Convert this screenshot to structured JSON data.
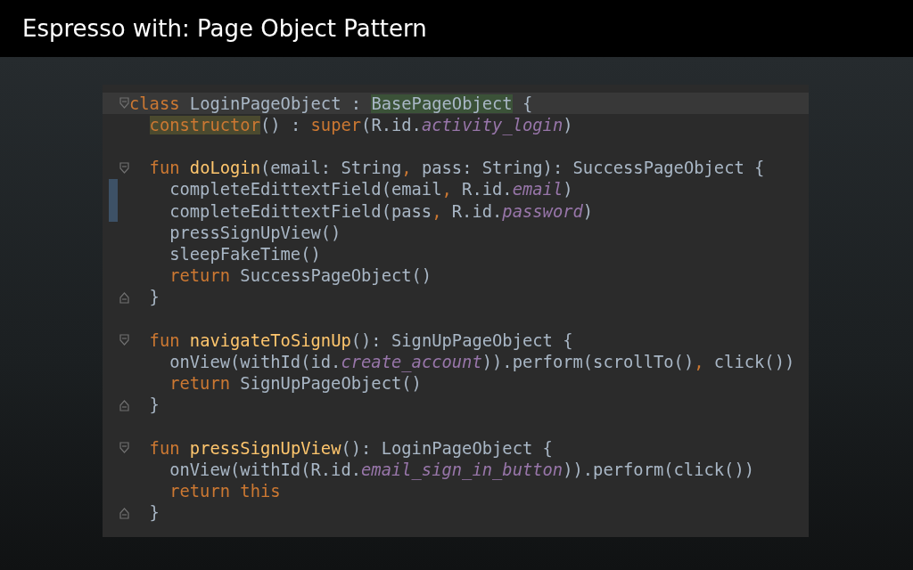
{
  "slide": {
    "title": "Espresso with: Page Object Pattern"
  },
  "editor": {
    "lines": [
      {
        "kind": "code",
        "fold_open": true,
        "current": true,
        "tokens": [
          {
            "t": "class ",
            "kind": "keyword"
          },
          {
            "t": "LoginPageObject : ",
            "kind": "plain"
          },
          {
            "t": "BasePageObject",
            "kind": "plain",
            "highlighted": true
          },
          {
            "t": " {",
            "kind": "plain"
          }
        ],
        "children": [
          {
            "kind": "code",
            "tokens": [
              {
                "t": "constructor",
                "kind": "keyword",
                "highlighted": true
              },
              {
                "t": "() : ",
                "kind": "plain"
              },
              {
                "t": "super",
                "kind": "keyword"
              },
              {
                "t": "(R.id.",
                "kind": "plain"
              },
              {
                "t": "activity_login",
                "kind": "field"
              },
              {
                "t": ")",
                "kind": "plain"
              }
            ]
          },
          {
            "kind": "blank"
          },
          {
            "kind": "code",
            "fold_open": true,
            "tokens": [
              {
                "t": "fun ",
                "kind": "keyword"
              },
              {
                "t": "doLogin",
                "kind": "decl"
              },
              {
                "t": "(email: String",
                "kind": "plain"
              },
              {
                "t": ", ",
                "kind": "keyword"
              },
              {
                "t": "pass: String): SuccessPageObject {",
                "kind": "plain"
              }
            ],
            "children": [
              {
                "kind": "code",
                "changed": true,
                "tokens": [
                  {
                    "t": "completeEdittextField(email",
                    "kind": "plain"
                  },
                  {
                    "t": ", ",
                    "kind": "keyword"
                  },
                  {
                    "t": "R.id.",
                    "kind": "plain"
                  },
                  {
                    "t": "email",
                    "kind": "field"
                  },
                  {
                    "t": ")",
                    "kind": "plain"
                  }
                ]
              },
              {
                "kind": "code",
                "changed": true,
                "tokens": [
                  {
                    "t": "completeEdittextField(pass",
                    "kind": "plain"
                  },
                  {
                    "t": ", ",
                    "kind": "keyword"
                  },
                  {
                    "t": "R.id.",
                    "kind": "plain"
                  },
                  {
                    "t": "password",
                    "kind": "field"
                  },
                  {
                    "t": ")",
                    "kind": "plain"
                  }
                ]
              },
              {
                "kind": "code",
                "tokens": [
                  {
                    "t": "pressSignUpView()",
                    "kind": "plain"
                  }
                ]
              },
              {
                "kind": "code",
                "tokens": [
                  {
                    "t": "sleepFakeTime()",
                    "kind": "plain"
                  }
                ]
              },
              {
                "kind": "code",
                "tokens": [
                  {
                    "t": "return ",
                    "kind": "keyword"
                  },
                  {
                    "t": "SuccessPageObject()",
                    "kind": "plain"
                  }
                ]
              }
            ]
          },
          {
            "kind": "code",
            "fold_close": true,
            "tokens": [
              {
                "t": "}",
                "kind": "plain"
              }
            ]
          },
          {
            "kind": "blank"
          },
          {
            "kind": "code",
            "fold_open": true,
            "tokens": [
              {
                "t": "fun ",
                "kind": "keyword"
              },
              {
                "t": "navigateToSignUp",
                "kind": "decl"
              },
              {
                "t": "(): SignUpPageObject {",
                "kind": "plain"
              }
            ],
            "children": [
              {
                "kind": "code",
                "tokens": [
                  {
                    "t": "onView(withId(id.",
                    "kind": "plain"
                  },
                  {
                    "t": "create_account",
                    "kind": "field"
                  },
                  {
                    "t": ")).perform(scrollTo()",
                    "kind": "plain"
                  },
                  {
                    "t": ", ",
                    "kind": "keyword"
                  },
                  {
                    "t": "click())",
                    "kind": "plain"
                  }
                ]
              },
              {
                "kind": "code",
                "tokens": [
                  {
                    "t": "return ",
                    "kind": "keyword"
                  },
                  {
                    "t": "SignUpPageObject()",
                    "kind": "plain"
                  }
                ]
              }
            ]
          },
          {
            "kind": "code",
            "fold_close": true,
            "tokens": [
              {
                "t": "}",
                "kind": "plain"
              }
            ]
          },
          {
            "kind": "blank"
          },
          {
            "kind": "code",
            "fold_open": true,
            "tokens": [
              {
                "t": "fun ",
                "kind": "keyword"
              },
              {
                "t": "pressSignUpView",
                "kind": "decl"
              },
              {
                "t": "(): LoginPageObject {",
                "kind": "plain"
              }
            ],
            "children": [
              {
                "kind": "code",
                "tokens": [
                  {
                    "t": "onView(withId(R.id.",
                    "kind": "plain"
                  },
                  {
                    "t": "email_sign_in_button",
                    "kind": "field"
                  },
                  {
                    "t": ")).perform(click())",
                    "kind": "plain"
                  }
                ]
              },
              {
                "kind": "code",
                "tokens": [
                  {
                    "t": "return this",
                    "kind": "keyword"
                  }
                ]
              }
            ]
          },
          {
            "kind": "code",
            "fold_close": true,
            "tokens": [
              {
                "t": "}",
                "kind": "plain"
              }
            ]
          }
        ]
      }
    ]
  }
}
